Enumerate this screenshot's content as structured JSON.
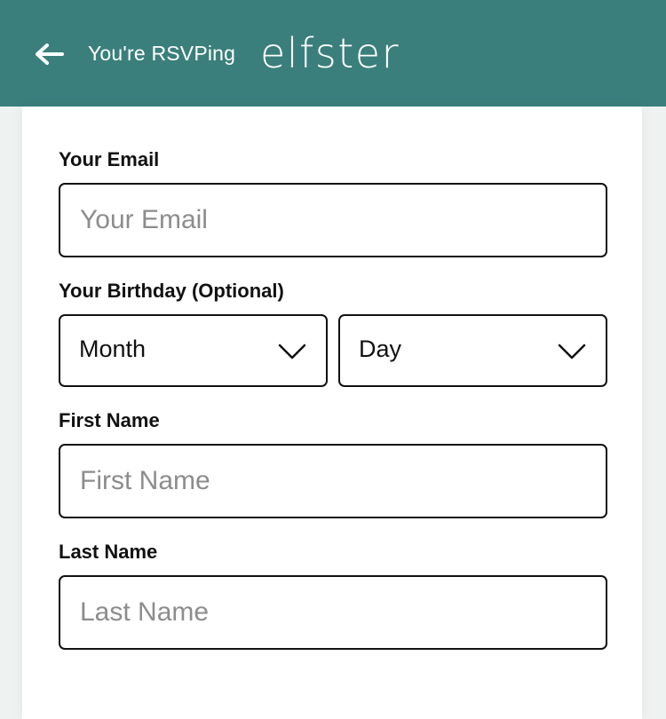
{
  "header": {
    "back_icon": "arrow-left-icon",
    "title": "You're RSVPing",
    "logo": "elfster",
    "background": "#3a7f7b"
  },
  "form": {
    "email": {
      "label": "Your Email",
      "placeholder": "Your Email",
      "value": ""
    },
    "birthday": {
      "label": "Your Birthday (Optional)",
      "month": {
        "selected": "Month",
        "icon": "chevron-down-icon"
      },
      "day": {
        "selected": "Day",
        "icon": "chevron-down-icon"
      }
    },
    "first_name": {
      "label": "First Name",
      "placeholder": "First Name",
      "value": ""
    },
    "last_name": {
      "label": "Last Name",
      "placeholder": "Last Name",
      "value": ""
    }
  }
}
